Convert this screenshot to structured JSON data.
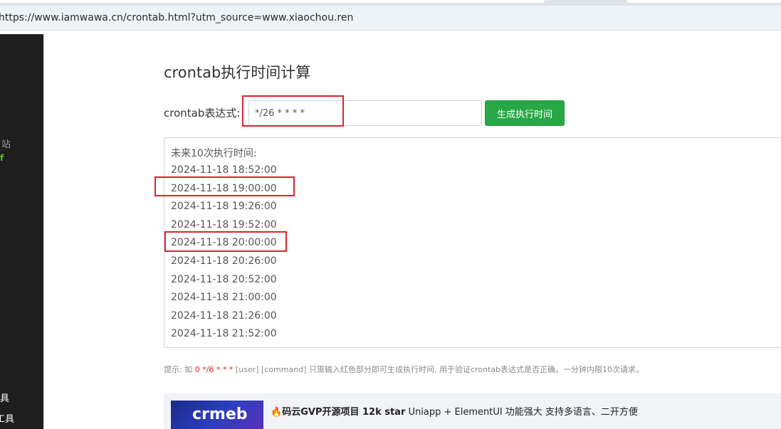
{
  "browser": {
    "url": "https://www.iamwawa.cn/crontab.html?utm_source=www.xiaochou.ren"
  },
  "sidebar": {
    "partial_text_1": "站",
    "partial_text_2": "具",
    "partial_text_3": "工具",
    "accent_glyph": "f"
  },
  "page": {
    "title": "crontab执行时间计算",
    "expression_label": "crontab表达式:",
    "expression_value": "*/26 * * * *",
    "generate_button": "生成执行时间",
    "result_title": "未来10次执行时间:",
    "times": [
      "2024-11-18 18:52:00",
      "2024-11-18 19:00:00",
      "2024-11-18 19:26:00",
      "2024-11-18 19:52:00",
      "2024-11-18 20:00:00",
      "2024-11-18 20:26:00",
      "2024-11-18 20:52:00",
      "2024-11-18 21:00:00",
      "2024-11-18 21:26:00",
      "2024-11-18 21:52:00"
    ],
    "hint_prefix": "提示: 如 ",
    "hint_red": "0 */6 * * *",
    "hint_suffix": " [user] [command] 只需输入红色部分即可生成执行时间, 用于验证crontab表达式是否正确。一分钟内限10次请求。"
  },
  "ad": {
    "logo_text": "crmeb",
    "emoji": "🔥",
    "bold_text": "码云GVP开源项目 12k star",
    "rest_text": " Uniapp + ElementUI 功能强大 支持多语言、二开方便"
  },
  "colors": {
    "accent_green": "#28a745",
    "highlight_red": "#d9262c",
    "sidebar_bg": "#1e1e1e"
  }
}
